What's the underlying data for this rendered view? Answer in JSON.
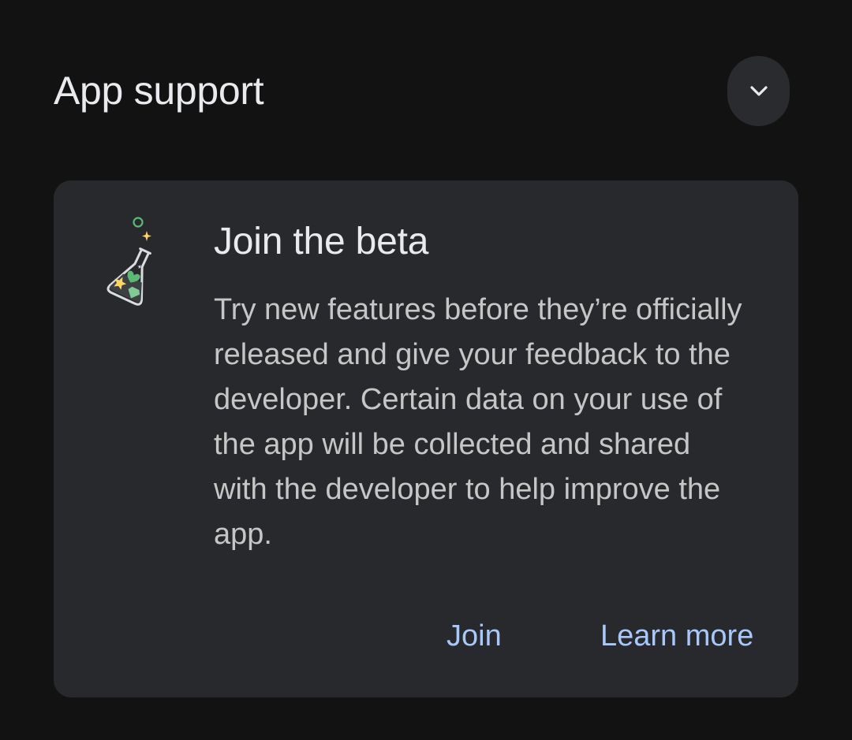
{
  "section": {
    "title": "App support",
    "expand_icon": "chevron-down-icon"
  },
  "beta_card": {
    "icon": "beta-flask-icon",
    "title": "Join the beta",
    "description": "Try new features before they’re officially released and give your feedback to the developer. Certain data on your use of the app will be collected and shared with the developer to help improve the app.",
    "actions": {
      "join_label": "Join",
      "learn_more_label": "Learn more"
    }
  },
  "colors": {
    "background": "#121212",
    "card_background": "#27292c",
    "button_background": "#2a2b2e",
    "primary_text": "#e8eaed",
    "secondary_text": "#c4c7c5",
    "accent": "#a8c7fa"
  }
}
